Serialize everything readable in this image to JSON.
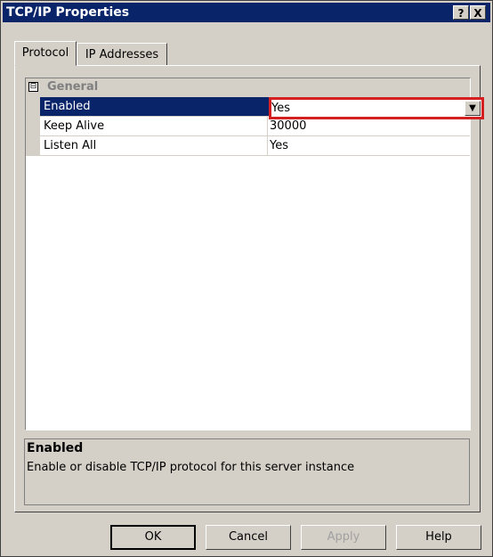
{
  "window": {
    "title": "TCP/IP Properties",
    "help_glyph": "?",
    "close_glyph": "X"
  },
  "tabs": [
    {
      "label": "Protocol"
    },
    {
      "label": "IP Addresses"
    }
  ],
  "grid": {
    "category": {
      "expander": "⊟",
      "label": "General"
    },
    "rows": [
      {
        "name": "Enabled",
        "value": "Yes"
      },
      {
        "name": "Keep Alive",
        "value": "30000"
      },
      {
        "name": "Listen All",
        "value": "Yes"
      }
    ]
  },
  "description": {
    "title": "Enabled",
    "text": "Enable or disable TCP/IP protocol for this server instance"
  },
  "buttons": {
    "ok": "OK",
    "cancel": "Cancel",
    "apply": "Apply",
    "help": "Help"
  },
  "colors": {
    "titlebar": "#0a246a",
    "selection": "#0a246a",
    "highlight_box": "#d42020",
    "dialog_bg": "#d4d0c8"
  }
}
